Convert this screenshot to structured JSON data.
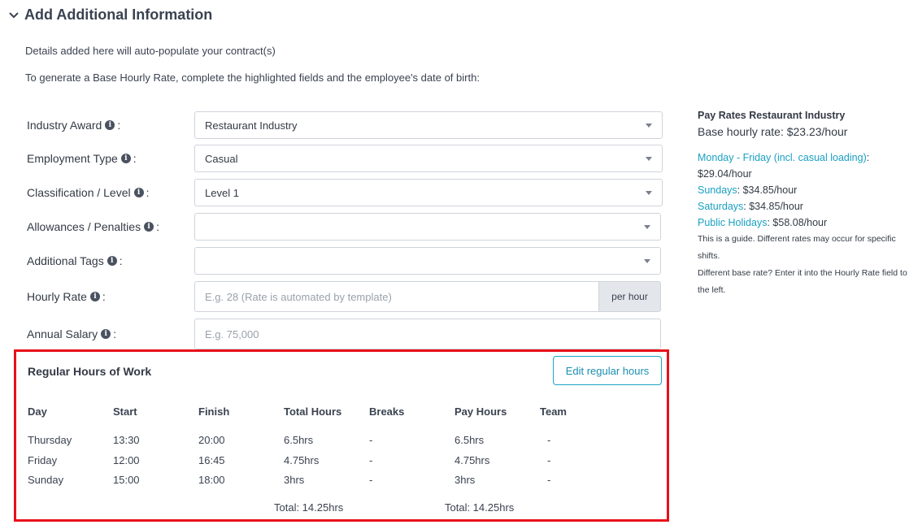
{
  "section": {
    "title": "Add Additional Information"
  },
  "intro": {
    "line1": "Details added here will auto-populate your contract(s)",
    "line2": "To generate a Base Hourly Rate, complete the highlighted fields and the employee's date of birth:"
  },
  "form": {
    "industry_award": {
      "label": "Industry Award",
      "value": "Restaurant Industry"
    },
    "employment_type": {
      "label": "Employment Type",
      "value": "Casual"
    },
    "classification": {
      "label": "Classification / Level",
      "value": "Level 1"
    },
    "allowances": {
      "label": "Allowances / Penalties",
      "value": ""
    },
    "tags": {
      "label": "Additional Tags",
      "value": ""
    },
    "hourly_rate": {
      "label": "Hourly Rate",
      "placeholder": "E.g. 28 (Rate is automated by template)",
      "addon": "per hour"
    },
    "annual_salary": {
      "label": "Annual Salary",
      "placeholder": "E.g. 75,000"
    }
  },
  "regular_hours": {
    "title": "Regular Hours of Work",
    "edit_label": "Edit regular hours",
    "columns": [
      "Day",
      "Start",
      "Finish",
      "Total Hours",
      "Breaks",
      "Pay Hours",
      "Team"
    ],
    "rows": [
      {
        "day": "Thursday",
        "start": "13:30",
        "finish": "20:00",
        "total": "6.5hrs",
        "breaks": "-",
        "pay": "6.5hrs",
        "team": "-"
      },
      {
        "day": "Friday",
        "start": "12:00",
        "finish": "16:45",
        "total": "4.75hrs",
        "breaks": "-",
        "pay": "4.75hrs",
        "team": "-"
      },
      {
        "day": "Sunday",
        "start": "15:00",
        "finish": "18:00",
        "total": "3hrs",
        "breaks": "-",
        "pay": "3hrs",
        "team": "-"
      }
    ],
    "total_hours": "Total: 14.25hrs",
    "total_pay_hours": "Total: 14.25hrs",
    "highlight_color": "#e8101b"
  },
  "pay_rates": {
    "title": "Pay Rates Restaurant Industry",
    "base": "Base hourly rate: $23.23/hour",
    "weekday_label": "Monday - Friday (incl. casual loading)",
    "weekday_value": "$29.04/hour",
    "sunday_label": "Sundays",
    "sunday_value": ": $34.85/hour",
    "saturday_label": "Saturdays",
    "saturday_value": ": $34.85/hour",
    "holiday_label": "Public Holidays",
    "holiday_value": ": $58.08/hour",
    "note1": "This is a guide. Different rates may occur for specific shifts.",
    "note2": "Different base rate? Enter it into the Hourly Rate field to the left.",
    "link_color": "#1aa0c2"
  }
}
